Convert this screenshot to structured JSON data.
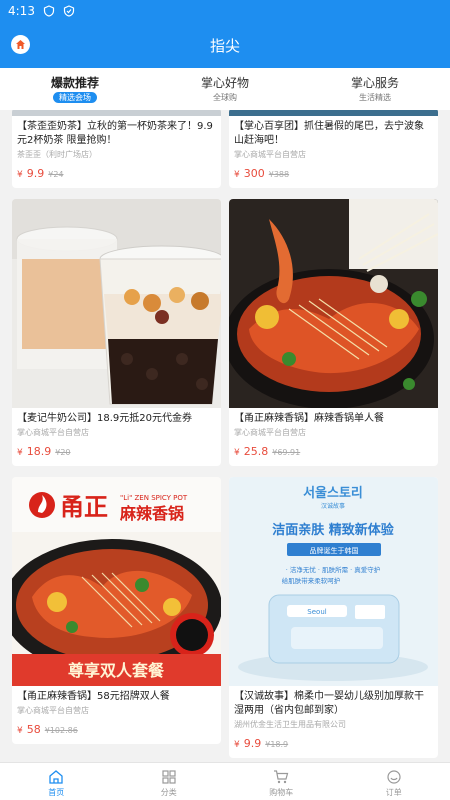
{
  "status": {
    "time": "4:13"
  },
  "header": {
    "title": "指尖"
  },
  "tabs": [
    {
      "label": "爆款推荐",
      "sub": "精选会场"
    },
    {
      "label": "掌心好物",
      "sub": "全球购"
    },
    {
      "label": "掌心服务",
      "sub": "生活精选"
    }
  ],
  "cards": [
    {
      "title": "【茶歪歪奶茶】立秋的第一杯奶茶来了！9.9元2杯奶茶 限量抢购！",
      "shop": "茶歪歪（利时广场店）",
      "yen": "¥",
      "price": "9.9",
      "old": "¥24"
    },
    {
      "title": "【掌心百享团】抓住暑假的尾巴，去宁波象山赶海吧！",
      "shop": "掌心商城平台自营店",
      "yen": "¥",
      "price": "300",
      "old": "¥388"
    },
    {
      "title": "【麦记牛奶公司】18.9元抵20元代金券",
      "shop": "掌心商城平台自营店",
      "yen": "¥",
      "price": "18.9",
      "old": "¥20"
    },
    {
      "title": "【甬正麻辣香锅】麻辣香锅单人餐",
      "shop": "掌心商城平台自营店",
      "yen": "¥",
      "price": "25.8",
      "old": "¥69.91"
    },
    {
      "title": "【甬正麻辣香锅】58元招牌双人餐",
      "shop": "掌心商城平台自营店",
      "yen": "¥",
      "price": "58",
      "old": "¥102.86"
    },
    {
      "title": "【汉诚故事】棉柔巾一婴幼儿级别加厚款干湿两用（省内包邮到家）",
      "shop": "湖州优金生活卫生用品有限公司",
      "yen": "¥",
      "price": "9.9",
      "old": "¥18.9"
    }
  ],
  "poster1": {
    "brand": "甬正",
    "name": "麻辣香锅",
    "en": "\"Li\" ZEN SPICY POT",
    "banner": "尊享双人套餐"
  },
  "poster2": {
    "brand": "서울스토리",
    "sub": "汉诚故事",
    "head": "洁面亲肤  精致新体验",
    "tag": "品牌诞生于韩国",
    "line1": "· 洁净无忧  · 肌肤所需  · 真爱守护",
    "line2": "给肌肤带来柔软呵护",
    "pack": "Seoul"
  },
  "bottomnav": [
    {
      "label": "首页"
    },
    {
      "label": "分类"
    },
    {
      "label": "购物车"
    },
    {
      "label": "订单"
    }
  ],
  "colors": {
    "accent": "#1e8ef0",
    "price": "#e84c3d"
  }
}
